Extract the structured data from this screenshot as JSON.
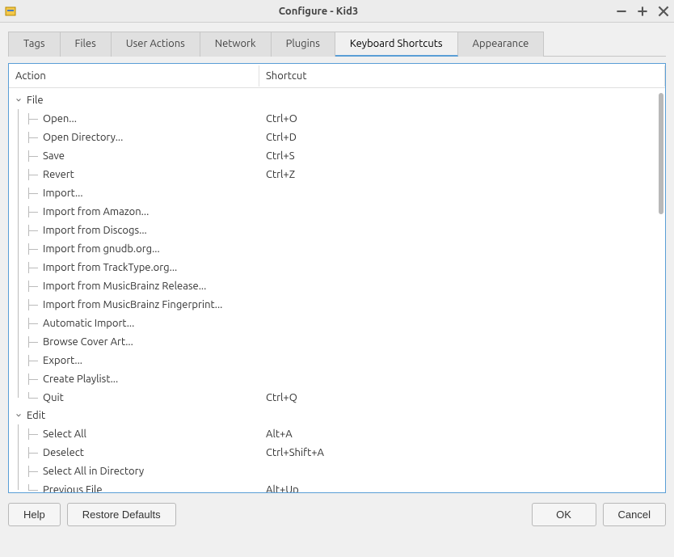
{
  "window": {
    "title": "Configure - Kid3"
  },
  "tabs": [
    {
      "id": "tags",
      "label": "Tags",
      "active": false
    },
    {
      "id": "files",
      "label": "Files",
      "active": false
    },
    {
      "id": "user-actions",
      "label": "User Actions",
      "active": false
    },
    {
      "id": "network",
      "label": "Network",
      "active": false
    },
    {
      "id": "plugins",
      "label": "Plugins",
      "active": false
    },
    {
      "id": "keyboard-shortcuts",
      "label": "Keyboard Shortcuts",
      "active": true
    },
    {
      "id": "appearance",
      "label": "Appearance",
      "active": false
    }
  ],
  "columns": {
    "action": "Action",
    "shortcut": "Shortcut"
  },
  "groups": [
    {
      "name": "File",
      "expanded": true,
      "items": [
        {
          "action": "Open...",
          "shortcut": "Ctrl+O"
        },
        {
          "action": "Open Directory...",
          "shortcut": "Ctrl+D"
        },
        {
          "action": "Save",
          "shortcut": "Ctrl+S"
        },
        {
          "action": "Revert",
          "shortcut": "Ctrl+Z"
        },
        {
          "action": "Import...",
          "shortcut": ""
        },
        {
          "action": "Import from Amazon...",
          "shortcut": ""
        },
        {
          "action": "Import from Discogs...",
          "shortcut": ""
        },
        {
          "action": "Import from gnudb.org...",
          "shortcut": ""
        },
        {
          "action": "Import from TrackType.org...",
          "shortcut": ""
        },
        {
          "action": "Import from MusicBrainz Release...",
          "shortcut": ""
        },
        {
          "action": "Import from MusicBrainz Fingerprint...",
          "shortcut": ""
        },
        {
          "action": "Automatic Import...",
          "shortcut": ""
        },
        {
          "action": "Browse Cover Art...",
          "shortcut": ""
        },
        {
          "action": "Export...",
          "shortcut": ""
        },
        {
          "action": "Create Playlist...",
          "shortcut": ""
        },
        {
          "action": "Quit",
          "shortcut": "Ctrl+Q"
        }
      ]
    },
    {
      "name": "Edit",
      "expanded": true,
      "items": [
        {
          "action": "Select All",
          "shortcut": "Alt+A"
        },
        {
          "action": "Deselect",
          "shortcut": "Ctrl+Shift+A"
        },
        {
          "action": "Select All in Directory",
          "shortcut": ""
        },
        {
          "action": "Previous File",
          "shortcut": "Alt+Up"
        }
      ]
    }
  ],
  "buttons": {
    "help": "Help",
    "restore_defaults": "Restore Defaults",
    "ok": "OK",
    "cancel": "Cancel"
  }
}
